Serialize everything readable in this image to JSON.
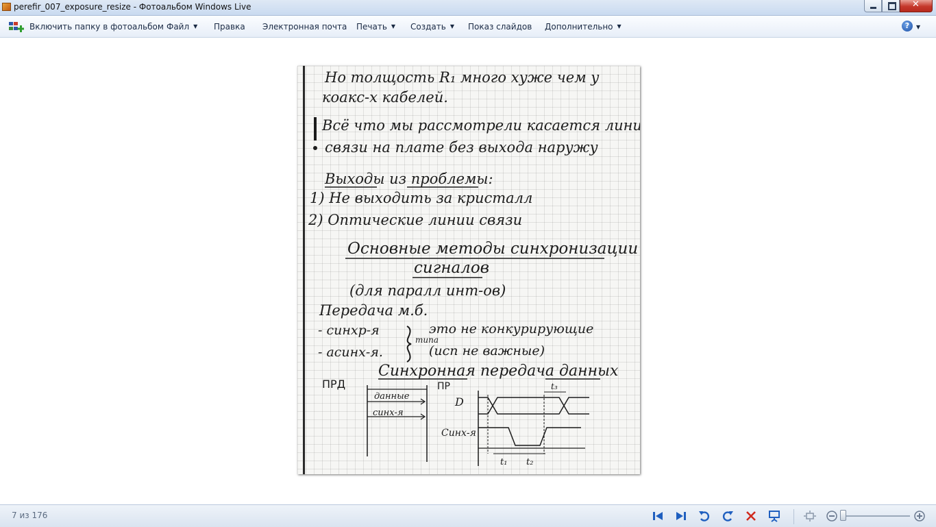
{
  "window": {
    "title": "perefir_007_exposure_resize - Фотоальбом Windows Live"
  },
  "toolbar": {
    "include_folder": "Включить папку в фотоальбом",
    "file": "Файл",
    "edit": "Правка",
    "email": "Электронная почта",
    "print": "Печать",
    "create": "Создать",
    "slideshow": "Показ слайдов",
    "more": "Дополнительно",
    "help": "?"
  },
  "status": {
    "counter": "7 из 176"
  },
  "photo": {
    "lines": [
      "Но толщость R₁ много хуже чем у",
      "коакс-х кабелей.",
      "Всё что мы рассмотрели касается линий",
      "связи на плате без выхода наружу",
      "Выходы из проблемы:",
      "1) Не выходить за кристалл",
      "2) Оптические линии связи",
      "Основные методы синхронизации",
      "сигналов",
      "(для паралл инт-ов)",
      "Передача м.б.",
      "- синхр-я",
      "- асинх-я.",
      "это не конкурирующие",
      "(исп не важные)",
      "типа",
      "Синхронная передача данных",
      "ПРД",
      "ПР",
      "данные",
      "синх-я",
      "D",
      "Синх-я",
      "t₃",
      "t₁",
      "t₂"
    ]
  }
}
